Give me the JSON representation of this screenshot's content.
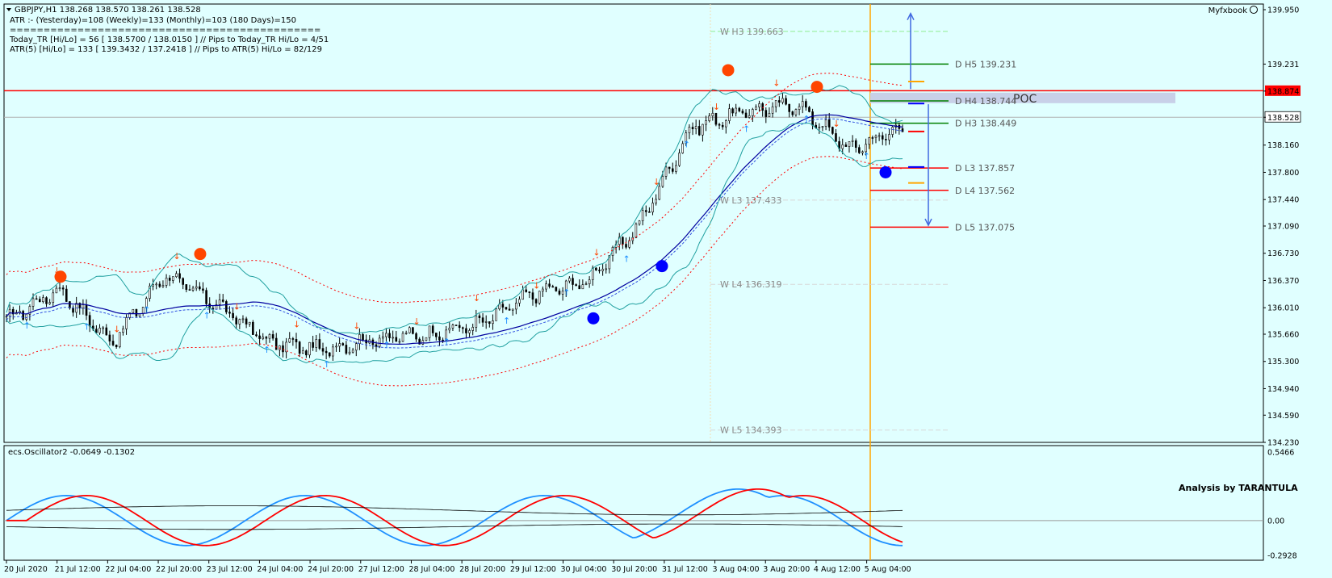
{
  "header": {
    "symbol_line": "GBPJPY,H1  138.268 138.570 138.261 138.528",
    "atr_line": "ATR :- (Yesterday)=108      (Weekly)=133      (Monthly)=103      (180 Days)=150",
    "separator": "==============================================",
    "today_tr_line": "Today_TR [Hi/Lo] = 56 [ 138.5700 / 138.0150 ]   // Pips to Today_TR Hi/Lo  = 4/51",
    "atr5_line": "ATR(5)       [Hi/Lo] = 133 [ 139.3432 / 137.2418 ]  //  Pips to ATR(5) Hi/Lo      = 82/129",
    "brand": "Myfxbook",
    "brand_icon": "smiley-icon"
  },
  "oscillator": {
    "label": "ecs.Oscillator2 -0.0649 -0.1302",
    "watermark": "Analysis by TARANTULA",
    "axis_labels": [
      "0.5466",
      "0.00",
      "-0.2928"
    ]
  },
  "price_axis": {
    "labels": [
      "139.950",
      "139.231",
      "138.874",
      "138.528",
      "138.160",
      "137.800",
      "137.440",
      "137.090",
      "136.730",
      "136.370",
      "136.010",
      "135.660",
      "135.300",
      "134.940",
      "134.590",
      "134.230"
    ],
    "highlight_red": "138.874",
    "highlight_current": "138.528"
  },
  "time_axis": {
    "labels": [
      "20 Jul 2020",
      "21 Jul 12:00",
      "22 Jul 04:00",
      "22 Jul 20:00",
      "23 Jul 12:00",
      "24 Jul 04:00",
      "24 Jul 20:00",
      "27 Jul 12:00",
      "28 Jul 04:00",
      "28 Jul 20:00",
      "29 Jul 12:00",
      "30 Jul 04:00",
      "30 Jul 20:00",
      "31 Jul 12:00",
      "3 Aug 04:00",
      "3 Aug 20:00",
      "4 Aug 12:00",
      "5 Aug 04:00"
    ]
  },
  "levels": {
    "weekly": [
      {
        "label": "W  H3 139.663",
        "price": 139.663
      },
      {
        "label": "W  L3 137.433",
        "price": 137.433
      },
      {
        "label": "W  L4 136.319",
        "price": 136.319
      },
      {
        "label": "W  L5 134.393",
        "price": 134.393
      }
    ],
    "daily": [
      {
        "label": "D  H5 139.231",
        "price": 139.231,
        "color": "#008000"
      },
      {
        "label": "D  H4 138.744",
        "price": 138.744,
        "color": "#008000"
      },
      {
        "label": "D  H3 138.449",
        "price": 138.449,
        "color": "#008000"
      },
      {
        "label": "D  L3 137.857",
        "price": 137.857,
        "color": "#ff0000"
      },
      {
        "label": "D  L4 137.562",
        "price": 137.562,
        "color": "#ff0000"
      },
      {
        "label": "D  L5 137.075",
        "price": 137.075,
        "color": "#ff0000"
      }
    ],
    "poc_label": "POC",
    "poc_price": 138.874,
    "current_price": 138.528
  },
  "colors": {
    "background": "#e0ffff",
    "candle": "#000000",
    "bollinger": "#20a0a0",
    "envelope": "#ff0000",
    "ma": "#0000a0",
    "osc_blue": "#1e90ff",
    "osc_red": "#ff0000",
    "poc_band": "#c8d0e8",
    "vline": "#ffa500",
    "dot_red": "#ff4500",
    "dot_blue": "#0000ff"
  },
  "chart_data": {
    "type": "line",
    "symbol": "GBPJPY",
    "timeframe": "H1",
    "ylim": [
      134.23,
      139.95
    ],
    "x": [
      "20 Jul 2020",
      "21 Jul 12:00",
      "22 Jul 04:00",
      "22 Jul 20:00",
      "23 Jul 12:00",
      "24 Jul 04:00",
      "24 Jul 20:00",
      "27 Jul 12:00",
      "28 Jul 04:00",
      "28 Jul 20:00",
      "29 Jul 12:00",
      "30 Jul 04:00",
      "30 Jul 20:00",
      "31 Jul 12:00",
      "3 Aug 04:00",
      "3 Aug 20:00",
      "4 Aug 12:00",
      "5 Aug 04:00"
    ],
    "series": [
      {
        "values": [
          135.85,
          136.25,
          135.55,
          136.45,
          136.05,
          135.55,
          135.45,
          135.6,
          135.65,
          135.8,
          136.2,
          136.35,
          137.1,
          138.4,
          138.6,
          138.7,
          138.1,
          138.4
        ]
      }
    ],
    "oscillator": {
      "ylim": [
        -0.2928,
        0.5466
      ]
    }
  }
}
